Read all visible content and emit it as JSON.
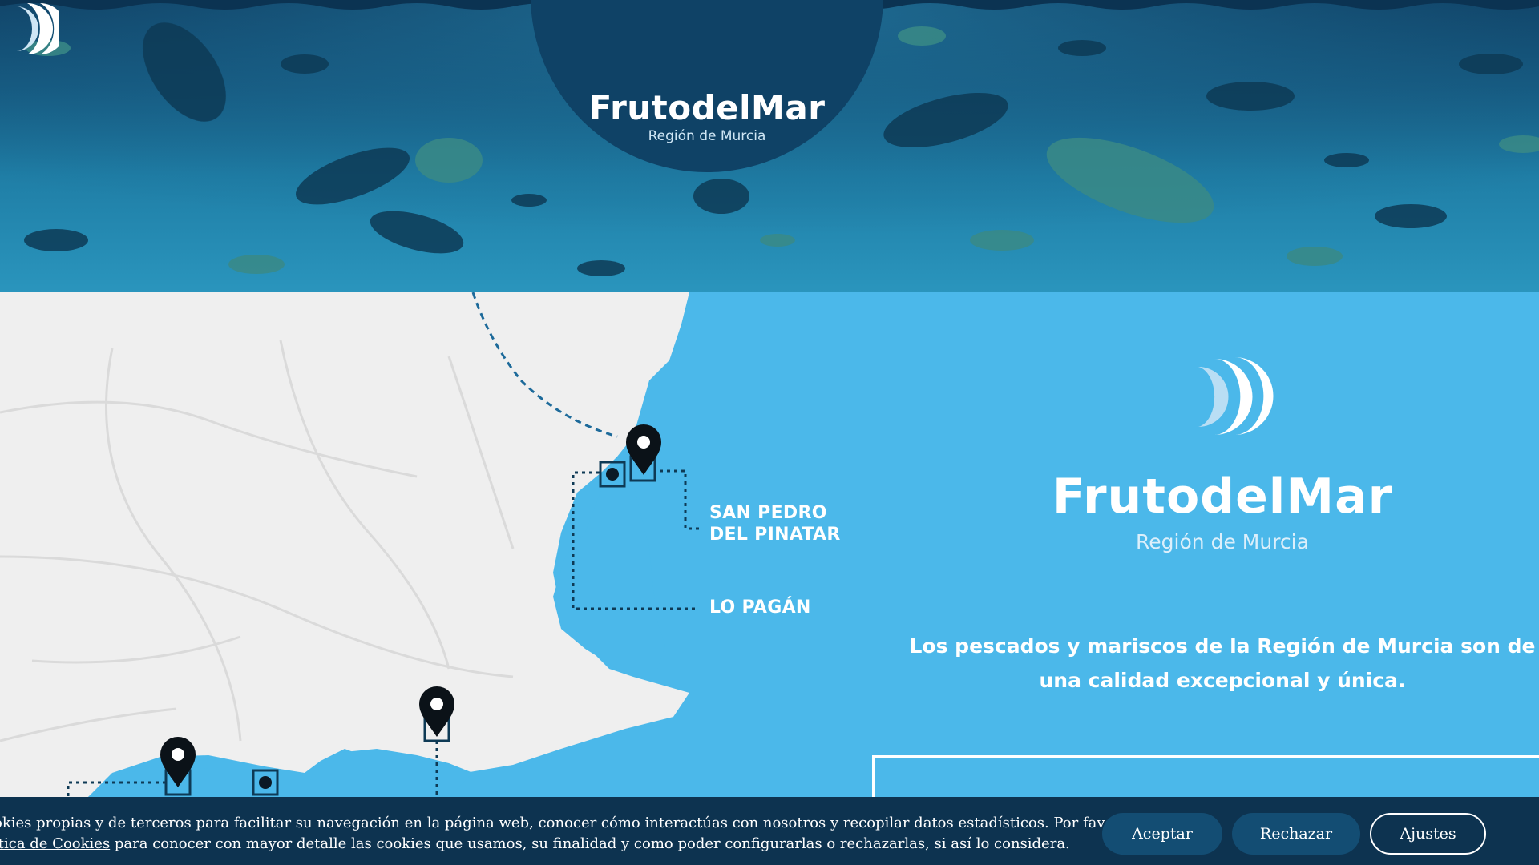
{
  "header": {
    "brand": "FrutodelMar",
    "subtitle": "Región de Murcia",
    "logo_icon": "crescent-waves-icon"
  },
  "map": {
    "pin_icon": "location-pin-icon",
    "labels": {
      "san_pedro_line1": "SAN PEDRO",
      "san_pedro_line2": "DEL PINATAR",
      "lo_pagan": "LO PAGÁN"
    }
  },
  "intro": {
    "brand": "FrutodelMar",
    "subtitle": "Región de Murcia",
    "text_line1": "Los pescados y mariscos de la Región de Murcia son de",
    "text_line2": "una calidad excepcional y única."
  },
  "cookie_banner": {
    "text_line1": "okies propias y de terceros para facilitar su navegación en la página web, conocer cómo interactúas con nosotros y recopilar datos estadísticos. Por favor,",
    "link_text": "ítica de Cookies",
    "text_line2_rest": " para conocer con mayor detalle las cookies que usamos, su finalidad y como poder configurarlas o rechazarlas, si así lo considera.",
    "accept_label": "Aceptar",
    "reject_label": "Rechazar",
    "settings_label": "Ajustes"
  },
  "colors": {
    "sea": "#4bb8ea",
    "land": "#efefef",
    "navy": "#0f4266",
    "cookie_bg": "#0d3350"
  }
}
